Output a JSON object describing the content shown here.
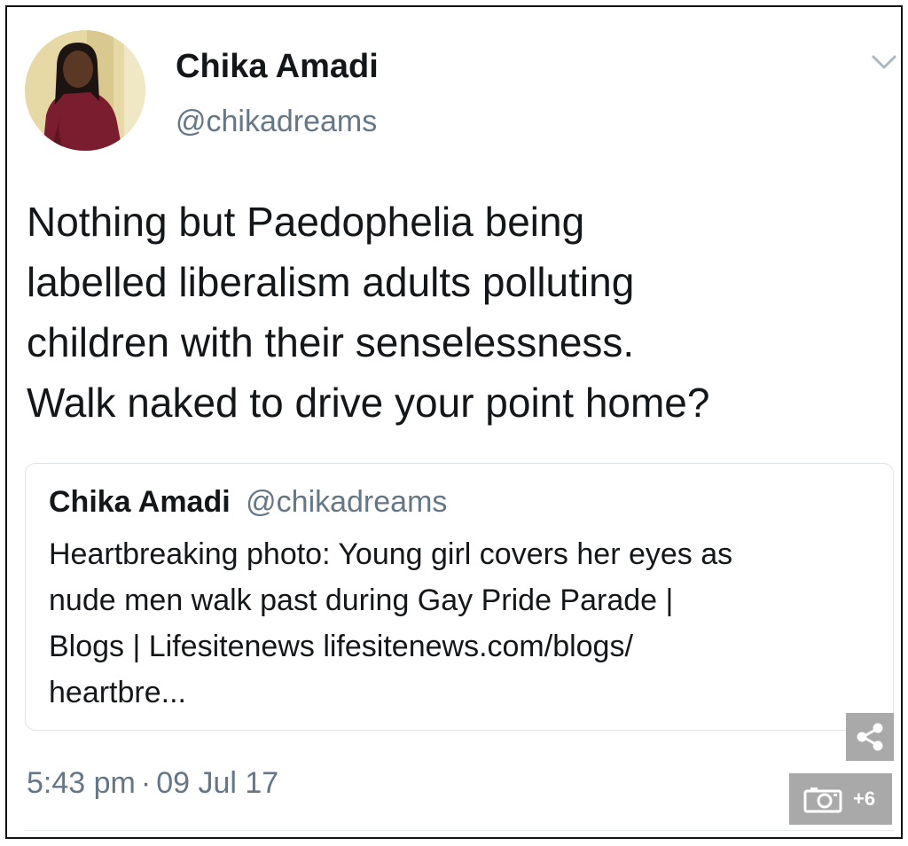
{
  "tweet": {
    "author": {
      "display_name": "Chika Amadi",
      "handle": "@chikadreams",
      "avatar_icon": "profile-photo"
    },
    "text_lines": [
      "Nothing but Paedophelia being",
      "labelled liberalism adults polluting",
      "children with their senselessness.",
      "Walk naked to drive your point home?"
    ],
    "quoted_tweet": {
      "display_name": "Chika Amadi",
      "handle": "@chikadreams",
      "text_lines": [
        "Heartbreaking photo: Young girl covers her eyes as",
        "nude men walk past during Gay Pride Parade |",
        "Blogs | Lifesitenews lifesitenews.com/blogs/",
        "heartbre..."
      ]
    },
    "time": "5:43 pm",
    "separator": "·",
    "date": "09 Jul 17"
  },
  "overlay": {
    "share_icon": "share-icon",
    "gallery_icon": "camera-icon",
    "gallery_count": "+6"
  },
  "colors": {
    "text_primary": "#14171a",
    "text_secondary": "#657786",
    "overlay_button": "#a9a9a9",
    "card_border": "#dfe4e8"
  }
}
